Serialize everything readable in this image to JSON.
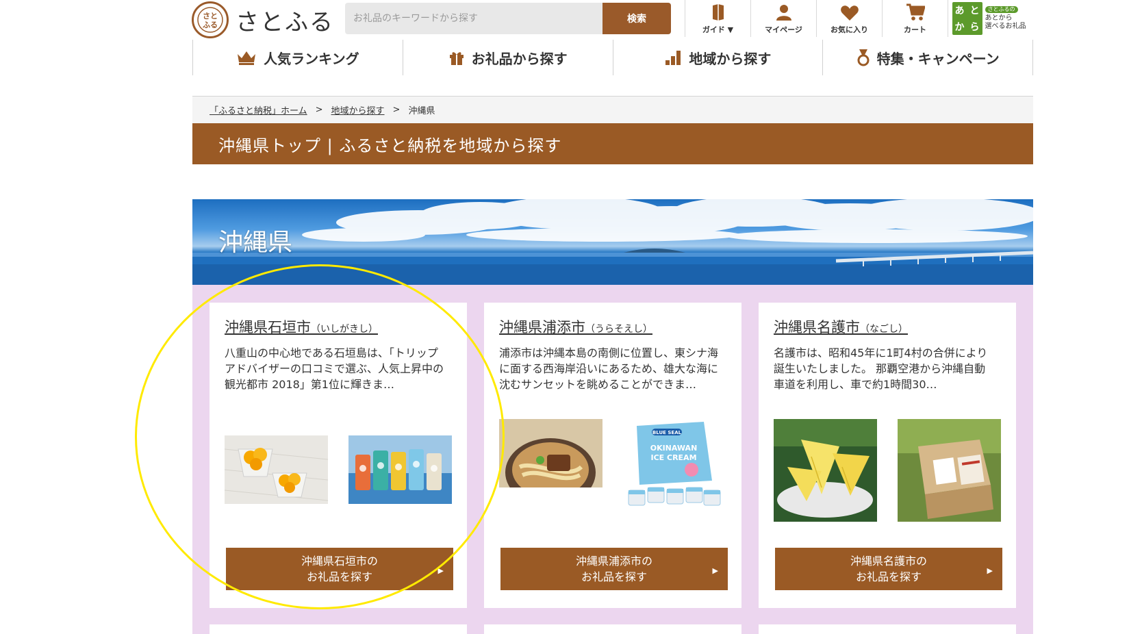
{
  "header": {
    "logo_text": "さとふる",
    "logo_mark": "さと\nふる",
    "search_placeholder": "お礼品のキーワードから探す",
    "search_button": "検索",
    "util_nav": [
      {
        "label": "ガイド ▼",
        "icon": "book-icon"
      },
      {
        "label": "マイページ",
        "icon": "user-icon"
      },
      {
        "label": "お気に入り",
        "icon": "heart-icon"
      },
      {
        "label": "カート",
        "icon": "cart-icon"
      }
    ],
    "atokara": {
      "badge": [
        "あ",
        "と",
        "か",
        "ら"
      ],
      "pill": "さとふるの",
      "line1": "あとから",
      "line2": "選べるお礼品"
    },
    "main_nav": [
      {
        "label": "人気ランキング",
        "icon": "crown-icon"
      },
      {
        "label": "お礼品から探す",
        "icon": "gift-icon"
      },
      {
        "label": "地域から探す",
        "icon": "region-icon"
      },
      {
        "label": "特集・キャンペーン",
        "icon": "medal-icon"
      }
    ]
  },
  "breadcrumb": {
    "items": [
      "「ふるさと納税」ホーム",
      "地域から探す",
      "沖縄県"
    ],
    "separator": ">"
  },
  "page_title": "沖縄県トップ | ふるさと納税を地域から探す",
  "banner_title": "沖縄県",
  "cards": [
    {
      "title": "沖縄県石垣市",
      "kana": "（いしがきし）",
      "description": "八重山の中心地である石垣島は、「トリップアドバイザーの口コミで選ぶ、人気上昇中の観光都市 2018」第1位に輝きま…",
      "button_line1": "沖縄県石垣市の",
      "button_line2": "お礼品を探す",
      "images": [
        "mango-dessert-image",
        "craft-beer-cans-image"
      ]
    },
    {
      "title": "沖縄県浦添市",
      "kana": "（うらそえし）",
      "description": "浦添市は沖縄本島の南側に位置し、東シナ海に面する西海岸沿いにあるため、雄大な海に沈むサンセットを眺めることができま…",
      "button_line1": "沖縄県浦添市の",
      "button_line2": "お礼品を探す",
      "images": [
        "okinawa-soba-image",
        "ice-cream-box-image"
      ],
      "ice_cream_text": [
        "BLUE SEAL",
        "OKINAWAN",
        "ICE CREAM"
      ]
    },
    {
      "title": "沖縄県名護市",
      "kana": "（なごし）",
      "description": "名護市は、昭和45年に1町4村の合併により誕生いたしました。 那覇空港から沖縄自動車道を利用し、車で約1時間30…",
      "button_line1": "沖縄県名護市の",
      "button_line2": "お礼品を探す",
      "images": [
        "pineapple-image",
        "gift-box-image"
      ]
    }
  ],
  "button_arrow": "▶",
  "colors": {
    "brand_brown": "#9a5a25",
    "cards_background": "#ecd6ef",
    "highlight": "#ffea00",
    "atokara_green": "#5c9a2b"
  }
}
